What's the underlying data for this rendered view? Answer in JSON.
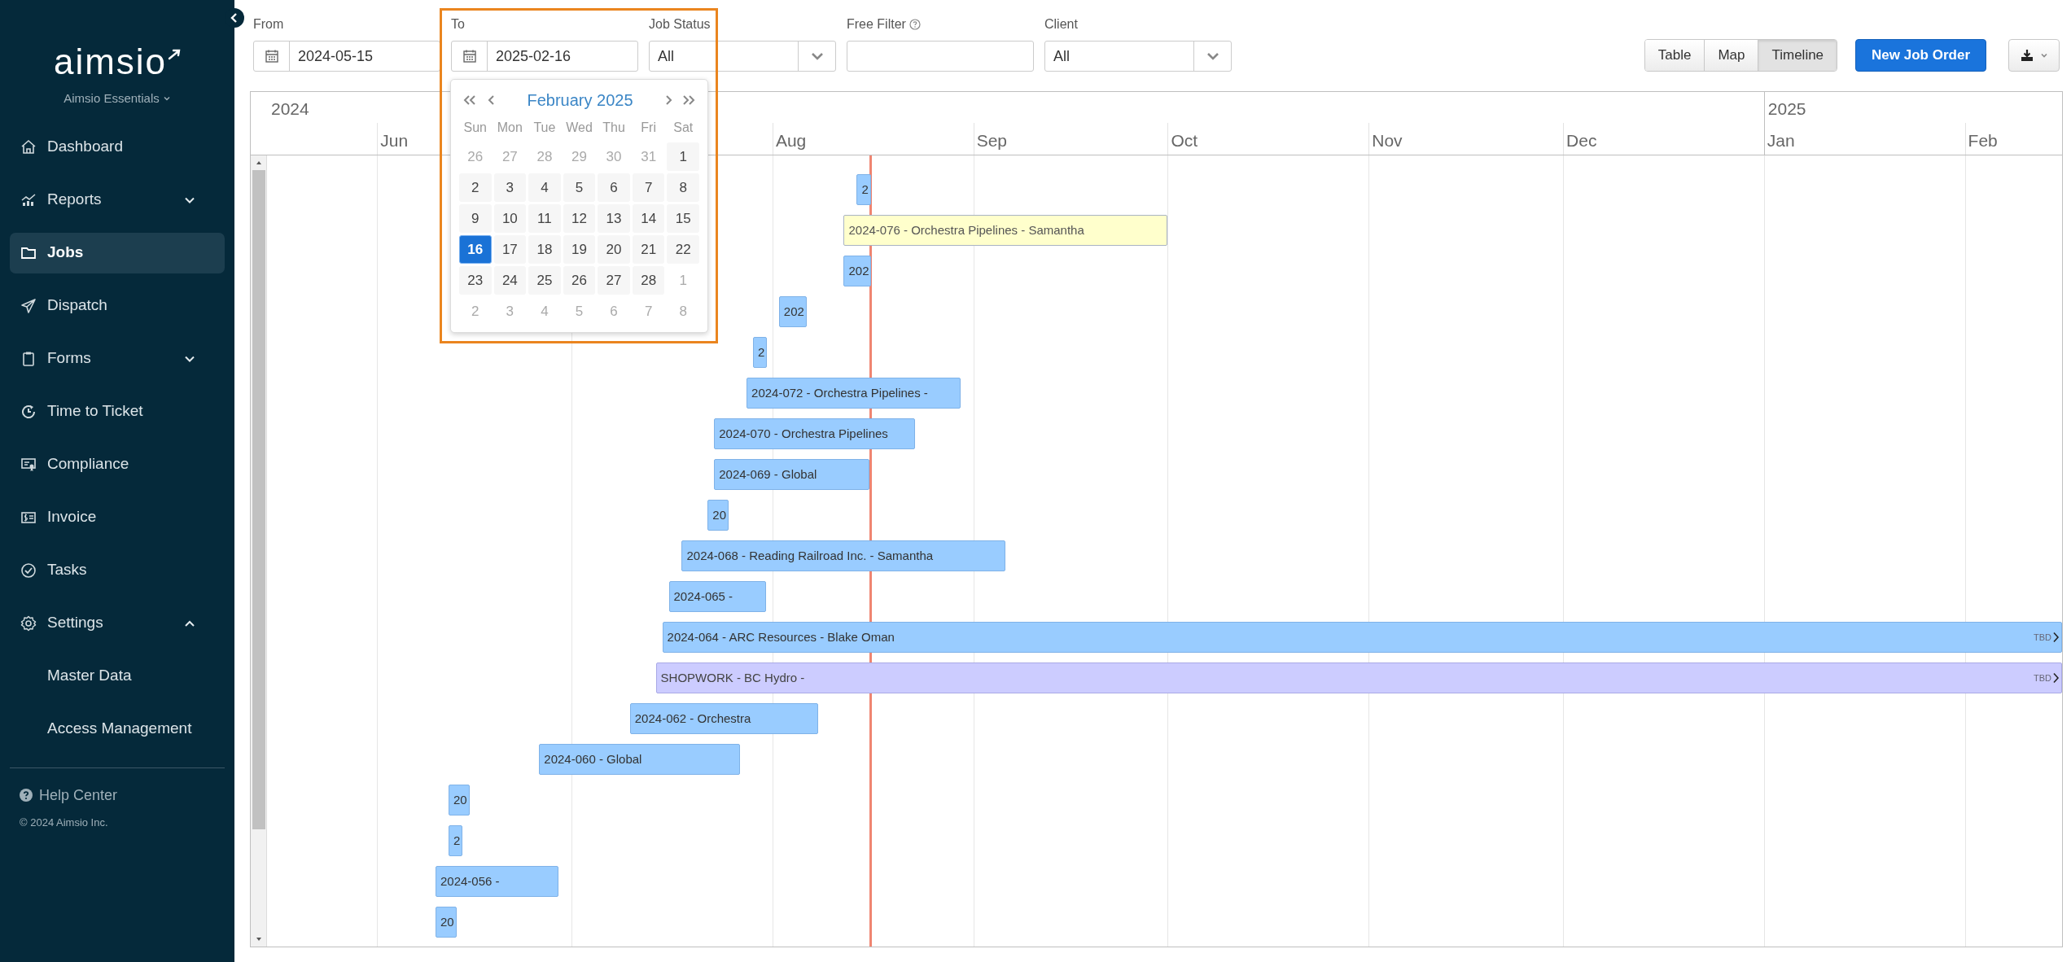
{
  "sidebar": {
    "logo": "aimsio",
    "workspace": "Aimsio Essentials",
    "items": [
      {
        "label": "Dashboard",
        "selected": false
      },
      {
        "label": "Reports",
        "selected": false,
        "expanded": false
      },
      {
        "label": "Jobs",
        "selected": true
      },
      {
        "label": "Dispatch",
        "selected": false
      },
      {
        "label": "Forms",
        "selected": false,
        "expanded": false
      },
      {
        "label": "Time to Ticket",
        "selected": false
      },
      {
        "label": "Compliance",
        "selected": false
      },
      {
        "label": "Invoice",
        "selected": false
      },
      {
        "label": "Tasks",
        "selected": false
      },
      {
        "label": "Settings",
        "selected": false,
        "expanded": true,
        "children": [
          {
            "label": "Master Data",
            "selected": false
          },
          {
            "label": "Access Management",
            "selected": false
          }
        ]
      }
    ],
    "help": "Help Center",
    "copyright": "© 2024 Aimsio Inc."
  },
  "highlight_frame": true,
  "filters": {
    "from": {
      "label": "From",
      "value": "2024-05-15"
    },
    "to": {
      "label": "To",
      "value": "2025-02-16"
    },
    "job_status": {
      "label": "Job Status",
      "value": "All"
    },
    "free_filter": {
      "label": "Free Filter"
    },
    "client": {
      "label": "Client",
      "value": "All"
    }
  },
  "date_picker": {
    "title": "February 2025",
    "weekdays": [
      "Sun",
      "Mon",
      "Tue",
      "Wed",
      "Thu",
      "Fri",
      "Sat"
    ],
    "weeks": [
      [
        {
          "day": "26",
          "outside": true,
          "selected": false
        },
        {
          "day": "27",
          "outside": true,
          "selected": false
        },
        {
          "day": "28",
          "outside": true,
          "selected": false
        },
        {
          "day": "29",
          "outside": true,
          "selected": false
        },
        {
          "day": "30",
          "outside": true,
          "selected": false
        },
        {
          "day": "31",
          "outside": true,
          "selected": false
        },
        {
          "day": "1",
          "outside": false,
          "selected": false
        }
      ],
      [
        {
          "day": "2",
          "outside": false,
          "selected": false
        },
        {
          "day": "3",
          "outside": false,
          "selected": false
        },
        {
          "day": "4",
          "outside": false,
          "selected": false
        },
        {
          "day": "5",
          "outside": false,
          "selected": false
        },
        {
          "day": "6",
          "outside": false,
          "selected": false
        },
        {
          "day": "7",
          "outside": false,
          "selected": false
        },
        {
          "day": "8",
          "outside": false,
          "selected": false
        }
      ],
      [
        {
          "day": "9",
          "outside": false,
          "selected": false
        },
        {
          "day": "10",
          "outside": false,
          "selected": false
        },
        {
          "day": "11",
          "outside": false,
          "selected": false
        },
        {
          "day": "12",
          "outside": false,
          "selected": false
        },
        {
          "day": "13",
          "outside": false,
          "selected": false
        },
        {
          "day": "14",
          "outside": false,
          "selected": false
        },
        {
          "day": "15",
          "outside": false,
          "selected": false
        }
      ],
      [
        {
          "day": "16",
          "outside": false,
          "selected": true
        },
        {
          "day": "17",
          "outside": false,
          "selected": false
        },
        {
          "day": "18",
          "outside": false,
          "selected": false
        },
        {
          "day": "19",
          "outside": false,
          "selected": false
        },
        {
          "day": "20",
          "outside": false,
          "selected": false
        },
        {
          "day": "21",
          "outside": false,
          "selected": false
        },
        {
          "day": "22",
          "outside": false,
          "selected": false
        }
      ],
      [
        {
          "day": "23",
          "outside": false,
          "selected": false
        },
        {
          "day": "24",
          "outside": false,
          "selected": false
        },
        {
          "day": "25",
          "outside": false,
          "selected": false
        },
        {
          "day": "26",
          "outside": false,
          "selected": false
        },
        {
          "day": "27",
          "outside": false,
          "selected": false
        },
        {
          "day": "28",
          "outside": false,
          "selected": false
        },
        {
          "day": "1",
          "outside": true,
          "selected": false
        }
      ],
      [
        {
          "day": "2",
          "outside": true,
          "selected": false
        },
        {
          "day": "3",
          "outside": true,
          "selected": false
        },
        {
          "day": "4",
          "outside": true,
          "selected": false
        },
        {
          "day": "5",
          "outside": true,
          "selected": false
        },
        {
          "day": "6",
          "outside": true,
          "selected": false
        },
        {
          "day": "7",
          "outside": true,
          "selected": false
        },
        {
          "day": "8",
          "outside": true,
          "selected": false
        }
      ]
    ]
  },
  "views": [
    {
      "label": "Table",
      "selected": false
    },
    {
      "label": "Map",
      "selected": false
    },
    {
      "label": "Timeline",
      "selected": true
    }
  ],
  "new_button": "New Job Order",
  "timeline": {
    "years": [
      "2024",
      "2025"
    ],
    "months": [
      "Jun",
      "Aug",
      "Sep",
      "Oct",
      "Nov",
      "Dec",
      "Jan",
      "Feb"
    ],
    "bars": [
      {
        "label": "2",
        "kind": "job",
        "selected": false
      },
      {
        "label": "2024-076 - Orchestra Pipelines - Samantha",
        "kind": "job",
        "selected": true
      },
      {
        "label": "202",
        "kind": "job",
        "selected": false
      },
      {
        "label": "202",
        "kind": "job",
        "selected": false
      },
      {
        "label": "2",
        "kind": "job",
        "selected": false
      },
      {
        "label": "2024-072 - Orchestra Pipelines -",
        "kind": "job",
        "selected": false
      },
      {
        "label": "2024-070 - Orchestra Pipelines",
        "kind": "job",
        "selected": false
      },
      {
        "label": "2024-069 - Global",
        "kind": "job",
        "selected": false
      },
      {
        "label": "20",
        "kind": "job",
        "selected": false
      },
      {
        "label": "2024-068 - Reading Railroad Inc. - Samantha",
        "kind": "job",
        "selected": false
      },
      {
        "label": "2024-065 -",
        "kind": "job",
        "selected": false
      },
      {
        "label": "2024-064 - ARC Resources - Blake Oman",
        "kind": "job",
        "selected": false,
        "end_label": "TBD"
      },
      {
        "label": "SHOPWORK - BC Hydro -",
        "kind": "shopwork",
        "selected": false,
        "end_label": "TBD"
      },
      {
        "label": "2024-062 - Orchestra",
        "kind": "job",
        "selected": false
      },
      {
        "label": "2024-060 - Global",
        "kind": "job",
        "selected": false
      },
      {
        "label": "20",
        "kind": "job",
        "selected": false
      },
      {
        "label": "2",
        "kind": "job",
        "selected": false
      },
      {
        "label": "2024-056 -",
        "kind": "job",
        "selected": false
      },
      {
        "label": "20",
        "kind": "job",
        "selected": false
      }
    ]
  }
}
